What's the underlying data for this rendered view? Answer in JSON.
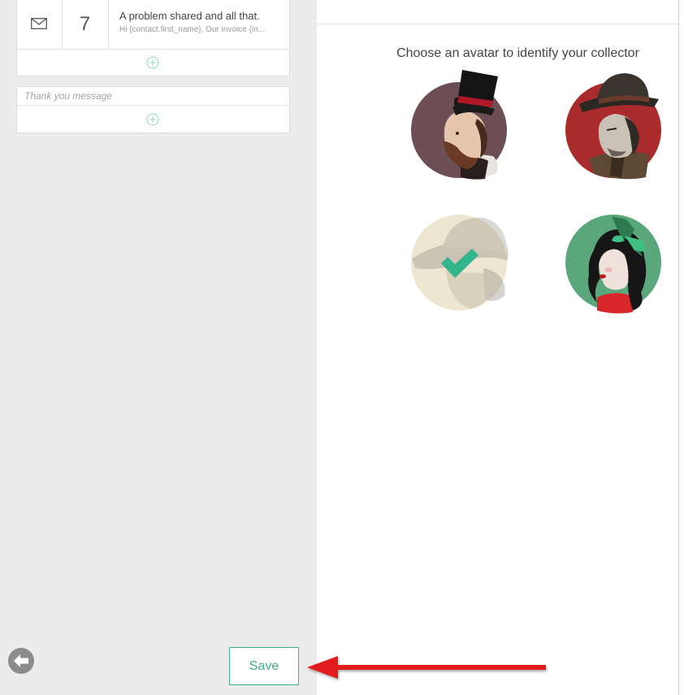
{
  "steps": [
    {
      "channel": "email",
      "day": "7",
      "title": "A problem shared and all that.",
      "preview": "Hi {contact.first_name}, Our invoice {in..."
    }
  ],
  "thank_you": {
    "placeholder": "Thank you message"
  },
  "footer": {
    "save_label": "Save"
  },
  "avatars": {
    "heading": "Choose an avatar to identify your collector",
    "items": [
      {
        "name": "gentleman-top-hat",
        "bg": "#6e4e55",
        "selected": false
      },
      {
        "name": "detective-fedora",
        "bg": "#a92b2b",
        "selected": false
      },
      {
        "name": "cowboy",
        "bg": "#efe6d2",
        "selected": true
      },
      {
        "name": "lady-green-bow",
        "bg": "#5aa77c",
        "selected": false
      }
    ]
  },
  "colors": {
    "accent": "#3fae84",
    "annotation_arrow": "#e01e1e",
    "check": "#33b58c"
  }
}
